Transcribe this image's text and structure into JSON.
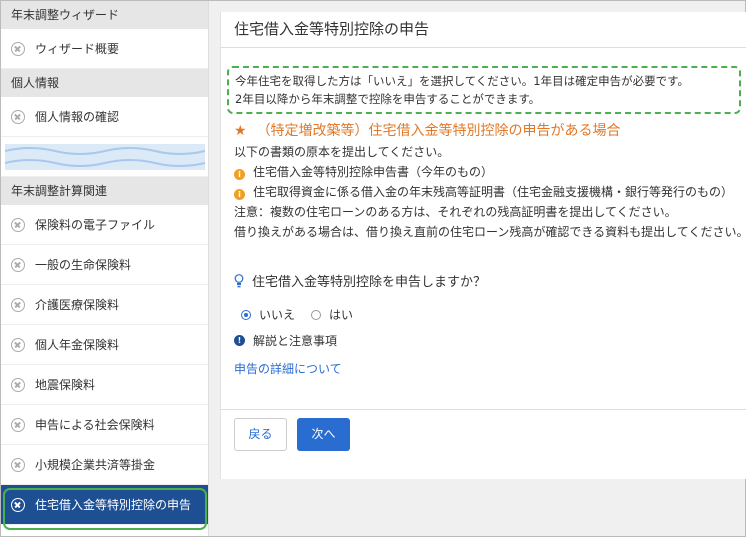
{
  "sidebar": {
    "sections": [
      {
        "header": "年末調整ウィザード",
        "items": [
          {
            "label": "ウィザード概要"
          }
        ]
      },
      {
        "header": "個人情報",
        "items": [
          {
            "label": "個人情報の確認"
          }
        ]
      },
      {
        "header": "年末調整計算関連",
        "items": [
          {
            "label": "保険料の電子ファイル"
          },
          {
            "label": "一般の生命保険料"
          },
          {
            "label": "介護医療保険料"
          },
          {
            "label": "個人年金保険料"
          },
          {
            "label": "地震保険料"
          },
          {
            "label": "申告による社会保険料"
          },
          {
            "label": "小規模企業共済等掛金"
          },
          {
            "label": "住宅借入金等特別控除の申告"
          }
        ]
      }
    ],
    "active_item": "住宅借入金等特別控除の申告"
  },
  "main": {
    "title": "住宅借入金等特別控除の申告",
    "notice_lines": [
      "今年住宅を取得した方は「いいえ」を選択してください。1年目は確定申告が必要です。",
      "2年目以降から年末調整で控除を申告することができます。"
    ],
    "heading": "（特定増改築等）住宅借入金等特別控除の申告がある場合",
    "lines": [
      "以下の書類の原本を提出してください。",
      "住宅借入金等特別控除申告書（今年のもの）",
      "住宅取得資金に係る借入金の年末残高等証明書（住宅金融支援機構・銀行等発行のもの）",
      "注意：複数の住宅ローンのある方は、それぞれの残高証明書を提出してください。",
      "借り換えがある場合は、借り換え直前の住宅ローン残高が確認できる資料も提出してください。"
    ],
    "question": "住宅借入金等特別控除を申告しますか？",
    "options": [
      "いいえ",
      "はい"
    ],
    "selected_option": "いいえ",
    "hints_label": "解説と注意事項",
    "details_link": "申告の詳細について",
    "back_label": "戻る",
    "next_label": "次へ"
  },
  "colors": {
    "accent": "#2a6dd0",
    "active_nav": "#1f4f93",
    "heading": "#e07828",
    "highlight_outline": "#4caf50"
  },
  "icons": [
    "remove-circle-icon",
    "star-icon",
    "info-icon",
    "lightbulb-icon",
    "exclamation-icon"
  ]
}
